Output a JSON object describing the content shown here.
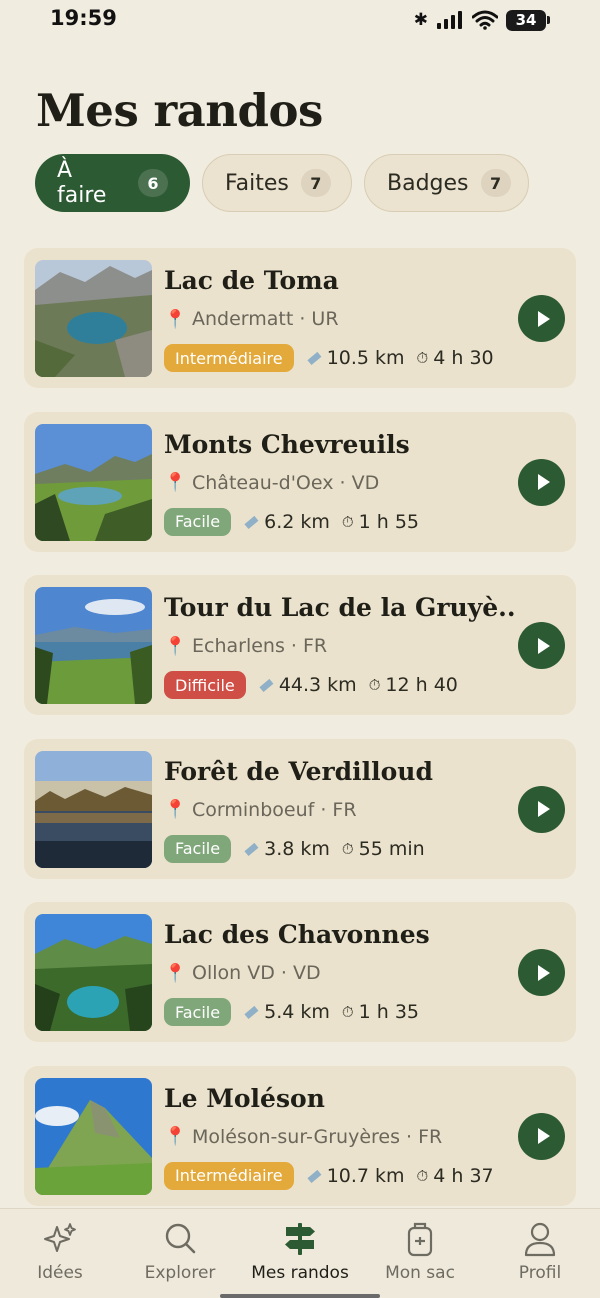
{
  "status": {
    "time": "19:59",
    "battery": "34"
  },
  "title": "Mes randos",
  "tabs": [
    {
      "label": "À faire",
      "count": "6",
      "active": true
    },
    {
      "label": "Faites",
      "count": "7",
      "active": false
    },
    {
      "label": "Badges",
      "count": "7",
      "active": false
    }
  ],
  "hikes": [
    {
      "name": "Lac de Toma",
      "location": "Andermatt · UR",
      "level": "Intermédiaire",
      "distance": "10.5 km",
      "duration": "4 h 30"
    },
    {
      "name": "Monts Chevreuils",
      "location": "Château-d'Oex · VD",
      "level": "Facile",
      "distance": "6.2 km",
      "duration": "1 h 55"
    },
    {
      "name": "Tour du Lac de la Gruyè...",
      "location": "Echarlens · FR",
      "level": "Difficile",
      "distance": "44.3 km",
      "duration": "12 h 40"
    },
    {
      "name": "Forêt de Verdilloud",
      "location": "Corminboeuf · FR",
      "level": "Facile",
      "distance": "3.8 km",
      "duration": "55 min"
    },
    {
      "name": "Lac des Chavonnes",
      "location": "Ollon VD · VD",
      "level": "Facile",
      "distance": "5.4 km",
      "duration": "1 h 35"
    },
    {
      "name": "Le Moléson",
      "location": "Moléson-sur-Gruyères · FR",
      "level": "Intermédiaire",
      "distance": "10.7 km",
      "duration": "4 h 37"
    }
  ],
  "nav": [
    {
      "label": "Idées",
      "icon": "sparkles-icon"
    },
    {
      "label": "Explorer",
      "icon": "search-icon"
    },
    {
      "label": "Mes randos",
      "icon": "signpost-icon",
      "active": true
    },
    {
      "label": "Mon sac",
      "icon": "backpack-icon"
    },
    {
      "label": "Profil",
      "icon": "user-icon"
    }
  ],
  "colors": {
    "background": "#f1ece0",
    "accent": "#2c5a32",
    "card": "#ebe2cd",
    "level_intermediate": "#e3a93b",
    "level_easy": "#7fa77a",
    "level_hard": "#cf4e45"
  }
}
